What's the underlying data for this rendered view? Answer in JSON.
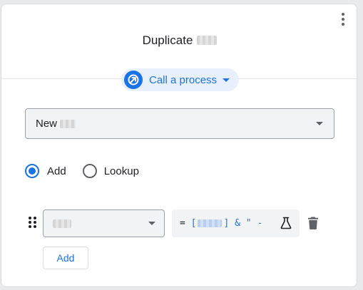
{
  "header": {
    "title": "Duplicate"
  },
  "process": {
    "label": "Call a process",
    "icon": "process-call-icon"
  },
  "target_select": {
    "value": "New"
  },
  "mode": {
    "options": [
      "Add",
      "Lookup"
    ],
    "selected": "Add"
  },
  "mapping_row": {
    "expression": {
      "eq": "=",
      "open_bracket": "[",
      "close_bracket": "]",
      "rest": "& \" -"
    }
  },
  "add_button_label": "Add",
  "colors": {
    "accent": "#1a73e8",
    "accent_light": "#e8f0fe",
    "field_bg": "#f1f3f4",
    "icon_gray": "#5f6368"
  }
}
